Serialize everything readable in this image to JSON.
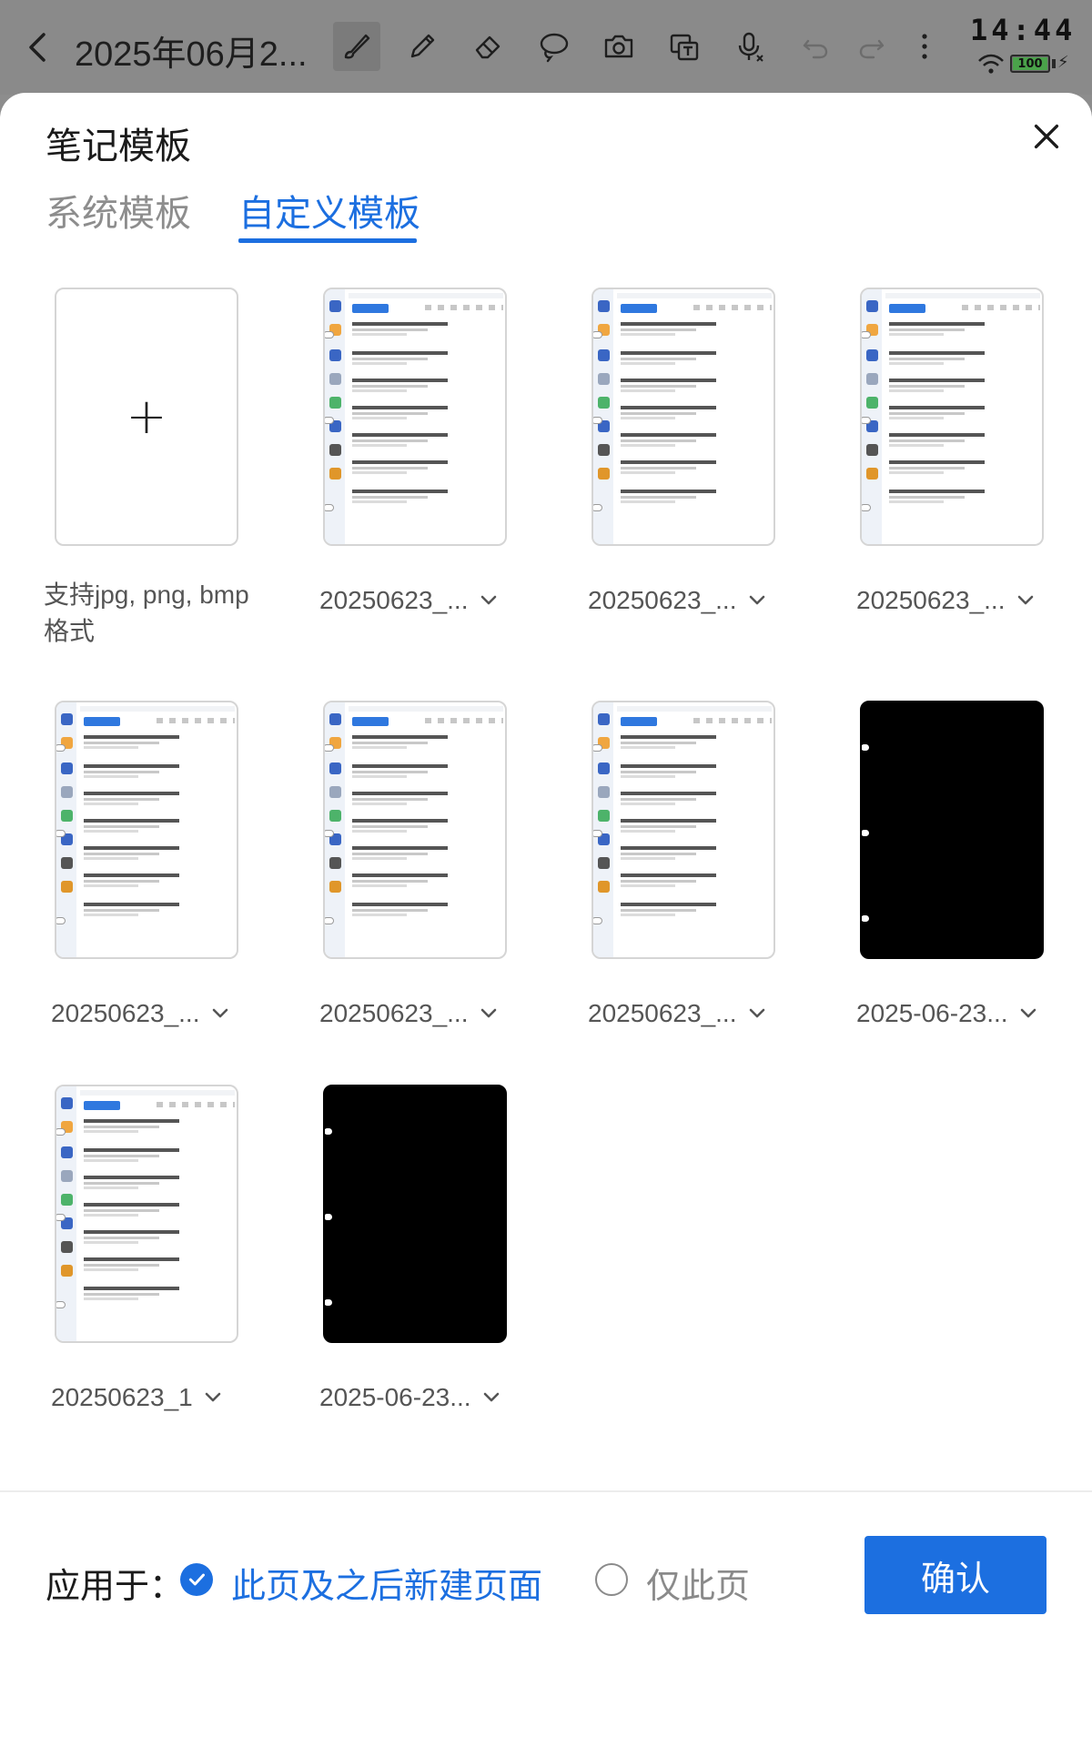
{
  "toolbar": {
    "title": "2025年06月2...",
    "clock": "14:44",
    "battery_level": "100",
    "tools": [
      "back-icon",
      "brush-icon",
      "pen-icon",
      "eraser-icon",
      "lasso-icon",
      "camera-icon",
      "text-recognition-icon",
      "voice-icon",
      "undo-icon",
      "redo-icon",
      "more-icon"
    ]
  },
  "sheet": {
    "title": "笔记模板",
    "tabs": [
      {
        "label": "系统模板",
        "active": false
      },
      {
        "label": "自定义模板",
        "active": true
      }
    ]
  },
  "templates": {
    "add_hint": "支持jpg, png, bmp格式",
    "items": [
      {
        "label": "20250623_...",
        "style": "screenshot"
      },
      {
        "label": "20250623_...",
        "style": "screenshot"
      },
      {
        "label": "20250623_...",
        "style": "screenshot"
      },
      {
        "label": "20250623_...",
        "style": "screenshot"
      },
      {
        "label": "20250623_...",
        "style": "screenshot"
      },
      {
        "label": "20250623_...",
        "style": "screenshot"
      },
      {
        "label": "2025-06-23...",
        "style": "black"
      },
      {
        "label": "20250623_1",
        "style": "screenshot"
      },
      {
        "label": "2025-06-23...",
        "style": "black"
      }
    ]
  },
  "footer": {
    "apply_label": "应用于：",
    "option_selected": "此页及之后新建页面",
    "option_other": "仅此页",
    "confirm_label": "确认"
  },
  "colors": {
    "accent": "#1c6fe0",
    "overlay": "#8a8a8a"
  }
}
